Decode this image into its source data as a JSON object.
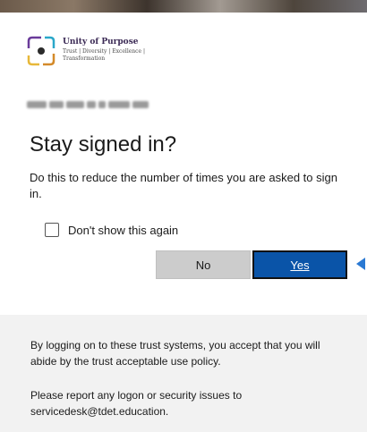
{
  "logo": {
    "name": "Unity of Purpose",
    "tagline": "Trust | Diversity | Excellence | Transformation"
  },
  "dialog": {
    "title": "Stay signed in?",
    "description": "Do this to reduce the number of times you are asked to sign in.",
    "checkbox_label": "Don't show this again",
    "checkbox_checked": false,
    "no_label": "No",
    "yes_label": "Yes"
  },
  "footer": {
    "policy_text": "By logging on to these trust systems, you accept that you will abide by the trust acceptable use policy.",
    "support_text": "Please report any logon or security issues to servicedesk@tdet.education."
  },
  "colors": {
    "primary_button": "#0a54a8",
    "secondary_button": "#cccccc",
    "footer_bg": "#f2f2f2",
    "arrow": "#2a79d3"
  }
}
